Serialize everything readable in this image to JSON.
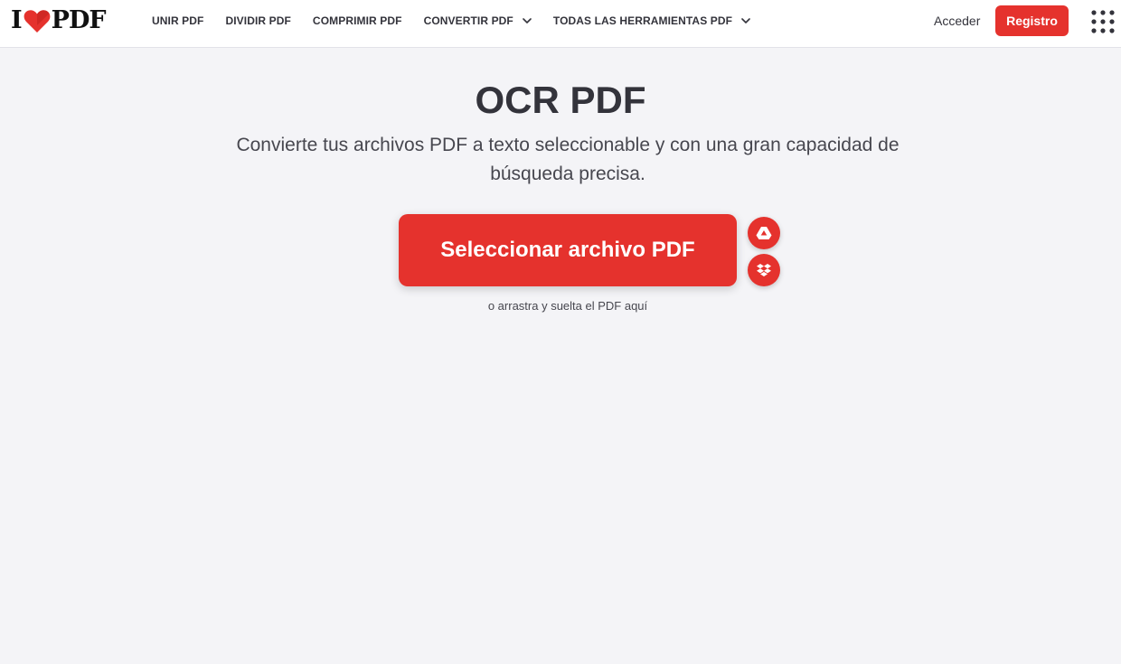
{
  "header": {
    "logo": {
      "left_text": "I",
      "right_text": "PDF",
      "heart_icon": "heart-icon"
    },
    "nav": [
      {
        "label": "UNIR PDF",
        "dropdown": false
      },
      {
        "label": "DIVIDIR PDF",
        "dropdown": false
      },
      {
        "label": "COMPRIMIR PDF",
        "dropdown": false
      },
      {
        "label": "CONVERTIR PDF",
        "dropdown": true
      },
      {
        "label": "TODAS LAS HERRAMIENTAS PDF",
        "dropdown": true
      }
    ],
    "login_label": "Acceder",
    "register_label": "Registro",
    "apps_icon": "grid-menu-icon"
  },
  "main": {
    "title": "OCR PDF",
    "subtitle": "Convierte tus archivos PDF a texto seleccionable y con una gran capacidad de búsqueda precisa.",
    "select_button_label": "Seleccionar archivo PDF",
    "drop_hint": "o arrastra y suelta el PDF aquí",
    "cloud_sources": [
      {
        "icon": "google-drive-icon"
      },
      {
        "icon": "dropbox-icon"
      }
    ]
  },
  "colors": {
    "accent": "#e5322d",
    "background": "#f4f4f7",
    "header_bg": "#ffffff",
    "text": "#33333b"
  }
}
